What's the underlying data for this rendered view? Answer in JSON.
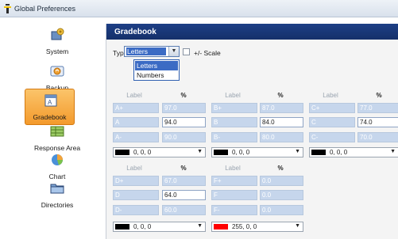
{
  "window": {
    "title": "Global Preferences"
  },
  "sidebar": {
    "items": [
      {
        "label": "System",
        "icon": "system-icon"
      },
      {
        "label": "Backup",
        "icon": "backup-icon"
      },
      {
        "label": "Gradebook",
        "icon": "gradebook-icon",
        "active": true
      },
      {
        "label": "Response Area",
        "icon": "response-area-icon"
      },
      {
        "label": "Chart",
        "icon": "chart-icon"
      },
      {
        "label": "Directories",
        "icon": "directories-icon"
      }
    ]
  },
  "panel": {
    "title": "Gradebook",
    "type_label": "Type:",
    "type_value": "Letters",
    "type_options": [
      "Letters",
      "Numbers"
    ],
    "scale_label": "+/- Scale",
    "col_label_header": "Label",
    "col_pct_header": "%",
    "groups_top": [
      {
        "rows": [
          {
            "label": "A+",
            "value": "97.0"
          },
          {
            "label": "A",
            "value": "94.0"
          },
          {
            "label": "A-",
            "value": "90.0"
          }
        ],
        "color_text": "0, 0, 0",
        "color_hex": "#000000"
      },
      {
        "rows": [
          {
            "label": "B+",
            "value": "87.0"
          },
          {
            "label": "B",
            "value": "84.0"
          },
          {
            "label": "B-",
            "value": "80.0"
          }
        ],
        "color_text": "0, 0, 0",
        "color_hex": "#000000"
      },
      {
        "rows": [
          {
            "label": "C+",
            "value": "77.0"
          },
          {
            "label": "C",
            "value": "74.0"
          },
          {
            "label": "C-",
            "value": "70.0"
          }
        ],
        "color_text": "0, 0, 0",
        "color_hex": "#000000"
      }
    ],
    "groups_bottom": [
      {
        "rows": [
          {
            "label": "D+",
            "value": "67.0"
          },
          {
            "label": "D",
            "value": "64.0"
          },
          {
            "label": "D-",
            "value": "60.0"
          }
        ],
        "color_text": "0, 0, 0",
        "color_hex": "#000000"
      },
      {
        "rows": [
          {
            "label": "F+",
            "value": "0.0"
          },
          {
            "label": "F",
            "value": "0.0"
          },
          {
            "label": "F-",
            "value": "0.0"
          }
        ],
        "color_text": "255, 0, 0",
        "color_hex": "#ff0000"
      }
    ]
  }
}
